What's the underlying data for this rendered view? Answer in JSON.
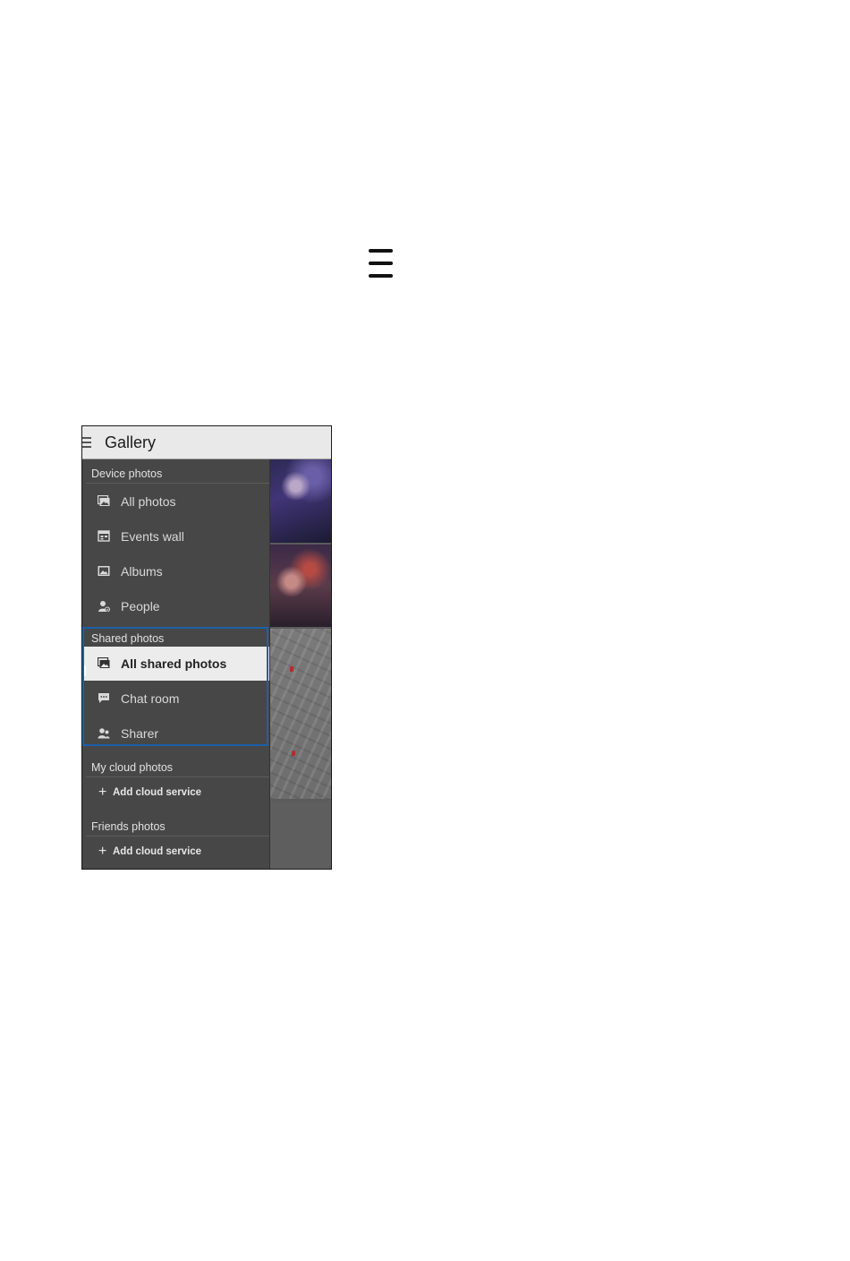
{
  "app": {
    "title": "Gallery"
  },
  "drawer": {
    "sections": [
      {
        "header": "Device photos",
        "items": [
          {
            "label": "All photos",
            "icon": "photos-icon"
          },
          {
            "label": "Events wall",
            "icon": "calendar-icon"
          },
          {
            "label": "Albums",
            "icon": "album-icon"
          },
          {
            "label": "People",
            "icon": "person-icon"
          }
        ]
      },
      {
        "header": "Shared photos",
        "items": [
          {
            "label": "All shared photos",
            "icon": "shared-photos-icon",
            "selected": true
          },
          {
            "label": "Chat room",
            "icon": "chat-icon"
          },
          {
            "label": "Sharer",
            "icon": "sharer-icon"
          }
        ]
      },
      {
        "header": "My cloud photos",
        "action": {
          "label": "Add cloud service",
          "icon": "plus-icon"
        }
      },
      {
        "header": "Friends photos",
        "action": {
          "label": "Add cloud service",
          "icon": "plus-icon"
        }
      }
    ]
  },
  "colors": {
    "highlight_border": "#1f5fa8",
    "drawer_background": "#474747",
    "selected_background": "#ececec",
    "appbar_background": "#e9e9e9"
  }
}
